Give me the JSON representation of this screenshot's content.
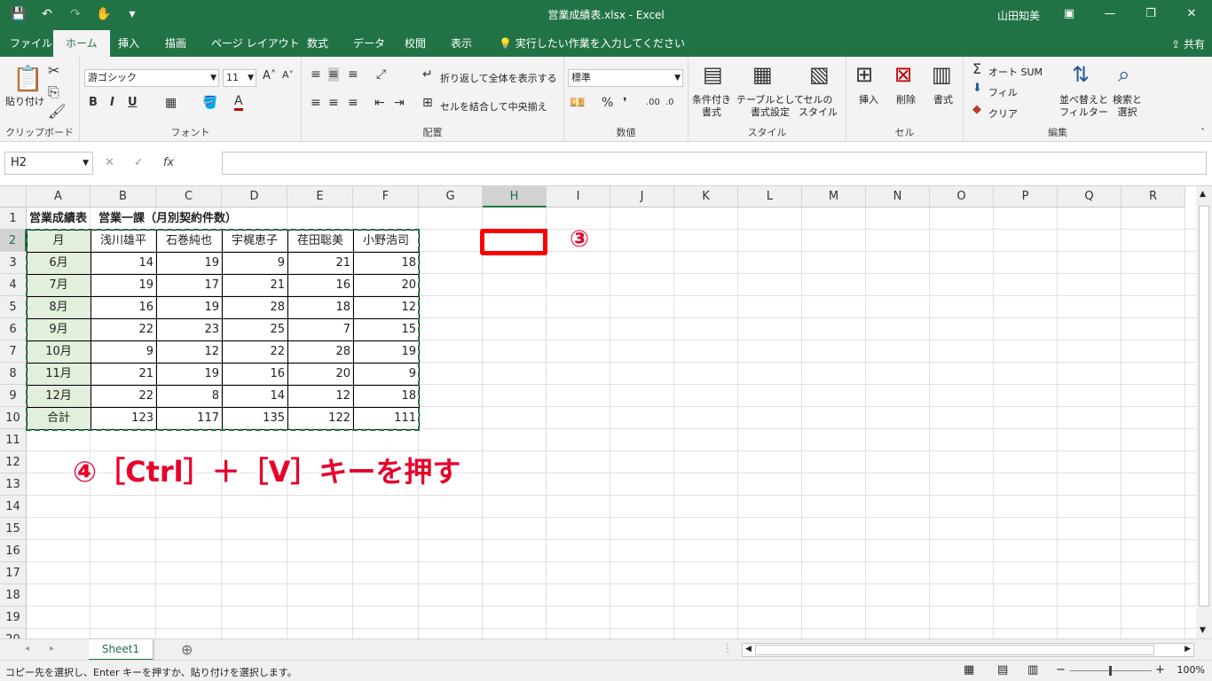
{
  "window": {
    "title": "営業成績表.xlsx  -  Excel",
    "user": "山田知美",
    "share": "共有",
    "qat": {
      "save": "💾",
      "undo": "↶",
      "redo": "↷",
      "touch": "✋",
      "more": "▾"
    },
    "buttons": {
      "ribbon_display": "▣",
      "minimize": "—",
      "restore": "❐",
      "close": "✕"
    }
  },
  "tabs": [
    "ファイル",
    "ホーム",
    "挿入",
    "描画",
    "ページ レイアウト",
    "数式",
    "データ",
    "校閲",
    "表示"
  ],
  "active_tab": "ホーム",
  "tell_me": "実行したい作業を入力してください",
  "ribbon": {
    "clipboard": {
      "paste": "貼り付け",
      "label": "クリップボード"
    },
    "font": {
      "name": "游ゴシック",
      "size": "11",
      "bold": "B",
      "italic": "I",
      "underline": "U",
      "label": "フォント"
    },
    "alignment": {
      "wrap": "折り返して全体を表示する",
      "merge": "セルを結合して中央揃え",
      "label": "配置"
    },
    "number": {
      "format": "標準",
      "percent": "%",
      "comma": "❜",
      "label": "数値"
    },
    "styles": {
      "conditional": [
        "条件付き",
        "書式"
      ],
      "table": [
        "テーブルとして",
        "書式設定"
      ],
      "cell": [
        "セルの",
        "スタイル"
      ],
      "label": "スタイル"
    },
    "cells": {
      "insert": "挿入",
      "delete": "削除",
      "format": "書式",
      "label": "セル"
    },
    "editing": {
      "autosum": "オート SUM",
      "fill": "フィル",
      "clear": "クリア",
      "sort": [
        "並べ替えと",
        "フィルター"
      ],
      "find": [
        "検索と",
        "選択"
      ],
      "label": "編集"
    }
  },
  "formula_bar": {
    "name_box": "H2",
    "cancel": "✕",
    "enter": "✓",
    "fx": "fx",
    "value": ""
  },
  "columns": [
    "A",
    "B",
    "C",
    "D",
    "E",
    "F",
    "G",
    "H",
    "I",
    "J",
    "K",
    "L",
    "M",
    "N",
    "O",
    "P",
    "Q",
    "R"
  ],
  "rows": [
    "1",
    "2",
    "3",
    "4",
    "5",
    "6",
    "7",
    "8",
    "9",
    "10",
    "11",
    "12",
    "13",
    "14",
    "15",
    "16",
    "17",
    "18",
    "19",
    "20"
  ],
  "sheet": {
    "title": "営業成績表　営業一課（月別契約件数）",
    "header_month": "月",
    "people": [
      "浅川雄平",
      "石巻純也",
      "宇梶恵子",
      "荏田聡美",
      "小野浩司"
    ],
    "months": [
      "6月",
      "7月",
      "8月",
      "9月",
      "10月",
      "11月",
      "12月"
    ],
    "values": [
      [
        14,
        19,
        9,
        21,
        18
      ],
      [
        19,
        17,
        21,
        16,
        20
      ],
      [
        16,
        19,
        28,
        18,
        12
      ],
      [
        22,
        23,
        25,
        7,
        15
      ],
      [
        9,
        12,
        22,
        28,
        19
      ],
      [
        21,
        19,
        16,
        20,
        9
      ],
      [
        22,
        8,
        14,
        12,
        18
      ]
    ],
    "total_label": "合計",
    "totals": [
      123,
      117,
      135,
      122,
      111
    ]
  },
  "annotations": {
    "step3": "③",
    "step4": "④［Ctrl］＋［V］キーを押す"
  },
  "sheet_tabs": {
    "active": "Sheet1",
    "add": "⊕",
    "prev": "◂",
    "next": "▸"
  },
  "status": {
    "message": "コピー先を選択し、Enter キーを押すか、貼り付けを選択します。",
    "zoom": "100%"
  }
}
